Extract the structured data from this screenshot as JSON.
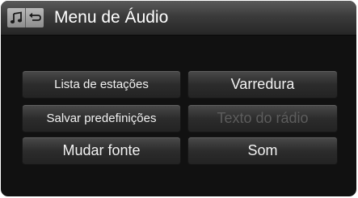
{
  "header": {
    "title": "Menu de Áudio",
    "icons": [
      "music-note-icon",
      "back-arrow-icon"
    ]
  },
  "menu": {
    "buttons": [
      {
        "label": "Lista de estações",
        "enabled": true
      },
      {
        "label": "Varredura",
        "enabled": true
      },
      {
        "label": "Salvar predefinições",
        "enabled": true
      },
      {
        "label": "Texto do rádio",
        "enabled": false
      },
      {
        "label": "Mudar fonte",
        "enabled": true
      },
      {
        "label": "Som",
        "enabled": true
      }
    ]
  },
  "colors": {
    "background": "#111111",
    "text": "#f2f2f2",
    "disabled_text": "#5d5d5d"
  }
}
